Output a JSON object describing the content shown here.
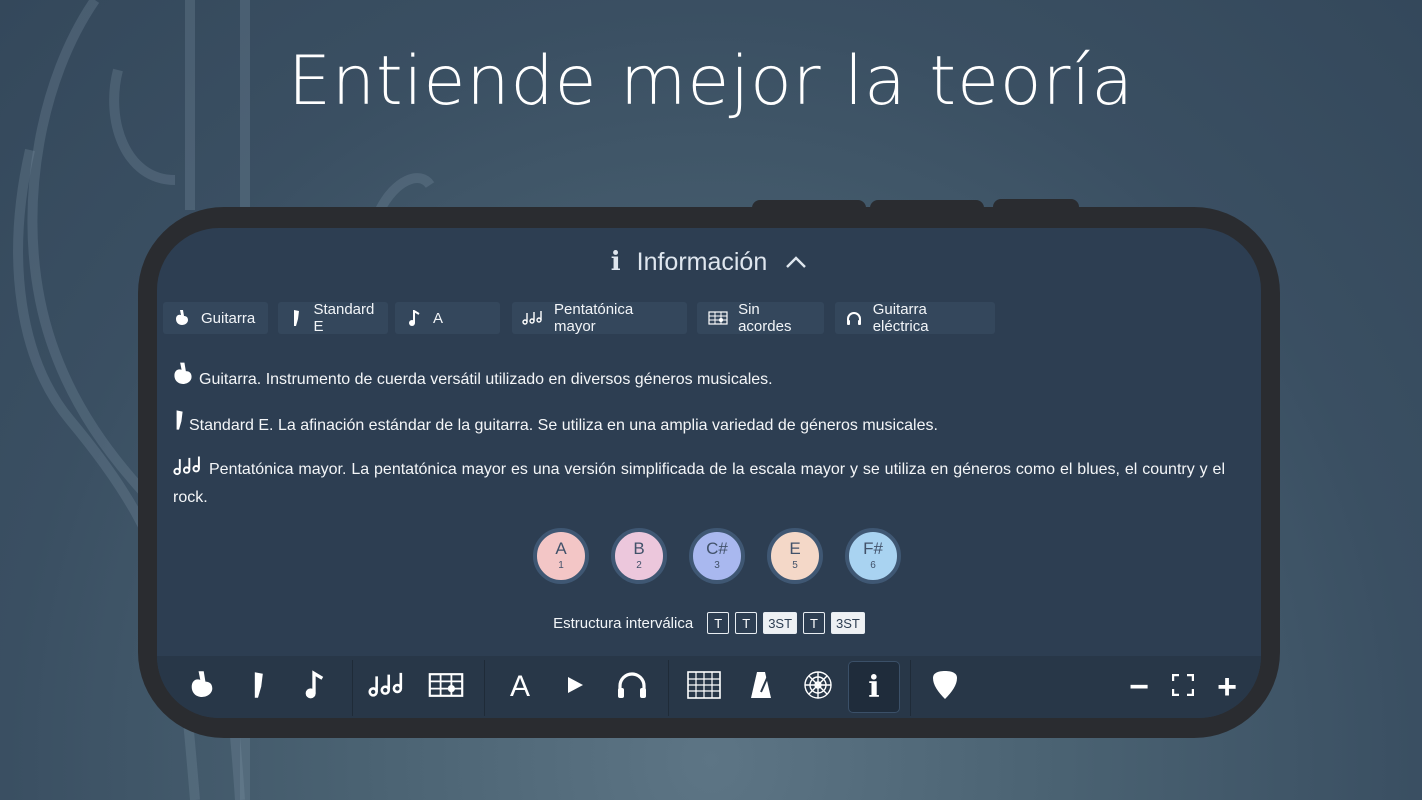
{
  "headline": "Entiende mejor la teoría",
  "info_panel": {
    "title": "Información",
    "info_glyph": "i",
    "caret": "^"
  },
  "chips": [
    {
      "label": "Guitarra",
      "icon": "guitar-body-icon"
    },
    {
      "label": "Standard E",
      "icon": "guitar-headstock-icon"
    },
    {
      "label": "A",
      "icon": "music-note-icon"
    },
    {
      "label": "Pentatónica mayor",
      "icon": "triple-notes-icon"
    },
    {
      "label": "Sin acordes",
      "icon": "chord-grid-icon"
    },
    {
      "label": "Guitarra eléctrica",
      "icon": "headphones-icon"
    }
  ],
  "descriptions": [
    {
      "icon": "guitar-body-icon",
      "text": "Guitarra. Instrumento de cuerda versátil utilizado en diversos géneros musicales."
    },
    {
      "icon": "guitar-headstock-icon",
      "text": "Standard E. La afinación estándar de la guitarra. Se utiliza en una amplia variedad de géneros musicales."
    },
    {
      "icon": "triple-notes-icon",
      "text": "Pentatónica mayor. La pentatónica mayor es una versión simplificada de la escala mayor y se utiliza en géneros como el blues, el country y el rock."
    }
  ],
  "scale_notes": [
    {
      "name": "A",
      "degree": "1",
      "color": "#f3c6c6"
    },
    {
      "name": "B",
      "degree": "2",
      "color": "#ecc7dc"
    },
    {
      "name": "C#",
      "degree": "3",
      "color": "#a9b8ef"
    },
    {
      "name": "E",
      "degree": "5",
      "color": "#f4d8c8"
    },
    {
      "name": "F#",
      "degree": "6",
      "color": "#a9d3f1"
    }
  ],
  "intervals": {
    "label": "Estructura interválica",
    "steps": [
      {
        "label": "T",
        "filled": false
      },
      {
        "label": "T",
        "filled": false
      },
      {
        "label": "3ST",
        "filled": true
      },
      {
        "label": "T",
        "filled": false
      },
      {
        "label": "3ST",
        "filled": true
      }
    ]
  },
  "toolbar": {
    "letter_label": "A",
    "info_label": "i",
    "zoom_out_label": "−",
    "zoom_in_label": "+",
    "active_item": "info"
  },
  "colors": {
    "screen_bg": "#2d3e52",
    "chip_bg": "#34475c",
    "toolbar_bg": "#283748",
    "phone_frame": "#2a2c30"
  }
}
